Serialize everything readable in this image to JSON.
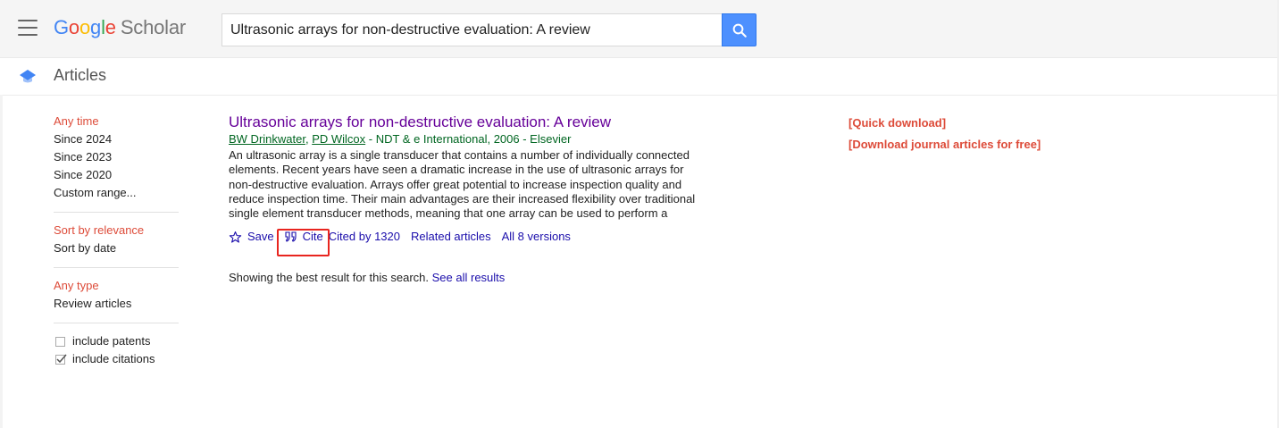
{
  "header": {
    "logo": {
      "g1": "G",
      "o1": "o",
      "o2": "o",
      "g2": "g",
      "l": "l",
      "e": "e",
      "scholar": "Scholar"
    },
    "search_value": "Ultrasonic arrays for non-destructive evaluation: A review",
    "icons": {
      "menu": "menu-icon",
      "search": "search-icon"
    },
    "colors": {
      "search_button": "#4d90fe"
    }
  },
  "subbar": {
    "title": "Articles",
    "icon": "graduation-cap-icon"
  },
  "sidebar": {
    "time": [
      "Any time",
      "Since 2024",
      "Since 2023",
      "Since 2020",
      "Custom range..."
    ],
    "sort": [
      "Sort by relevance",
      "Sort by date"
    ],
    "type": [
      "Any type",
      "Review articles"
    ],
    "checkboxes": [
      {
        "label": "include patents",
        "checked": false
      },
      {
        "label": "include citations",
        "checked": true
      }
    ],
    "colors": {
      "active": "#dd4b39"
    }
  },
  "result": {
    "title": "Ultrasonic arrays for non-destructive evaluation: A review",
    "authors": [
      "BW Drinkwater",
      "PD Wilcox"
    ],
    "source": " - NDT & e International, 2006 - Elsevier",
    "snippet": "An ultrasonic array is a single transducer that contains a number of individually connected elements. Recent years have seen a dramatic increase in the use of ultrasonic arrays for non-destructive evaluation. Arrays offer great potential to increase inspection quality and reduce inspection time. Their main advantages are their increased flexibility over traditional single element transducer methods, meaning that one array can be used to perform a number of different inspections, and their ability to produce immediate images of the test …",
    "actions": {
      "save": "Save",
      "cite": "Cite",
      "cited_by": "Cited by 1320",
      "related": "Related articles",
      "versions": "All 8 versions"
    },
    "colors": {
      "title": "#660099",
      "meta": "#006621",
      "link": "#1a0dab",
      "highlight": "#e8251f"
    }
  },
  "footer_note": {
    "text": "Showing the best result for this search.",
    "link": "See all results"
  },
  "right_links": [
    "[Quick download]",
    "[Download journal articles for free]"
  ]
}
